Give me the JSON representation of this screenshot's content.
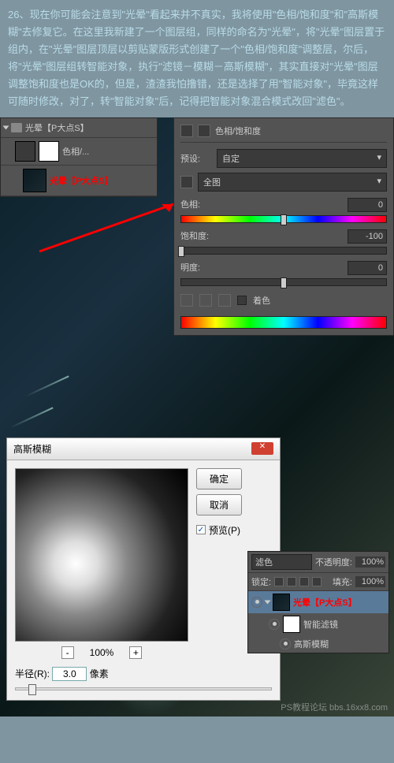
{
  "tutorial": {
    "text": "26、现在你可能会注意到\"光晕\"看起来并不真实，我将使用\"色相/饱和度\"和\"高斯模糊\"去修复它。在这里我新建了一个图层组，同样的命名为\"光晕\"，将\"光晕\"图层置于组内，在\"光晕\"图层顶层以剪贴蒙版形式创建了一个\"色相/饱和度\"调整层，尔后，将\"光晕\"图层组转智能对象，执行\"滤镜－模糊－高斯模糊\"，其实直接对\"光晕\"图层调整饱和度也是OK的，但是，渣渣我怕撸错，还是选择了用\"智能对象\"，毕竟这样可随时修改，对了，转\"智能对象\"后，记得把智能对象混合模式改回\"滤色\"。"
  },
  "layers_top": {
    "group_name": "光晕【P大点S】",
    "adj_name": "色相/...",
    "layer_name": "光晕【P大点S】"
  },
  "huesat": {
    "title": "色相/饱和度",
    "preset_label": "预设:",
    "preset_value": "自定",
    "range_value": "全图",
    "hue_label": "色相:",
    "hue_value": "0",
    "sat_label": "饱和度:",
    "sat_value": "-100",
    "light_label": "明度:",
    "light_value": "0",
    "colorize": "着色"
  },
  "gblur": {
    "title": "高斯模糊",
    "ok": "确定",
    "cancel": "取消",
    "preview": "预览(P)",
    "zoom": "100%",
    "radius_label": "半径(R):",
    "radius_value": "3.0",
    "radius_unit": "像素"
  },
  "layers_btm": {
    "blend": "滤色",
    "opacity_label": "不透明度:",
    "opacity": "100%",
    "lock_label": "锁定:",
    "fill_label": "填充:",
    "fill": "100%",
    "layer1": "光晕【P大点S】",
    "layer2": "智能滤镜",
    "layer3": "高斯模糊"
  },
  "watermark": "PS教程论坛\nbbs.16xx8.com"
}
